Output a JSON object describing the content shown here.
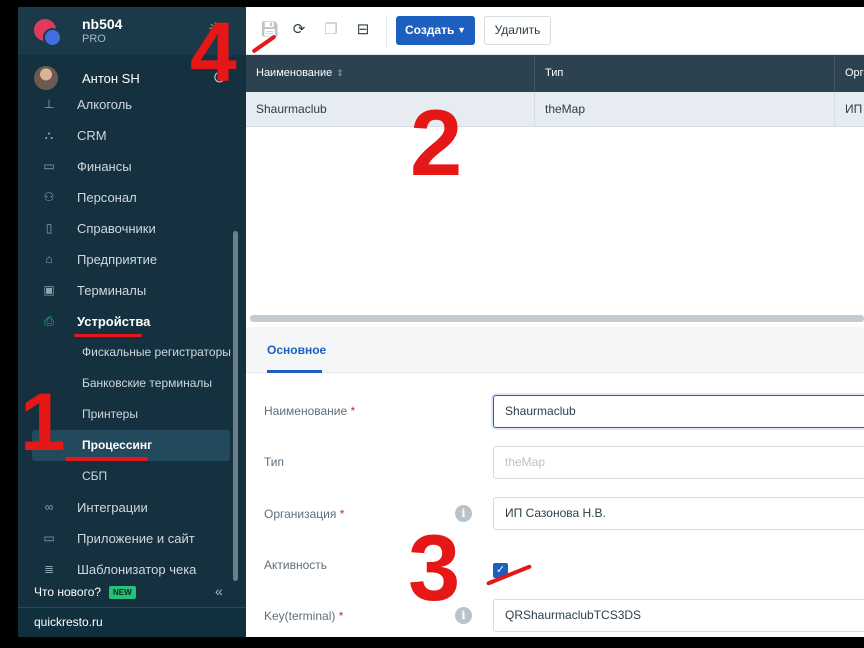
{
  "account": {
    "name": "nb504",
    "plan": "PRO"
  },
  "user": {
    "name": "Антон SH"
  },
  "sidebar": {
    "items": [
      {
        "label": "Алкоголь",
        "icon": "glass-icon"
      },
      {
        "label": "CRM",
        "icon": "org-chart-icon"
      },
      {
        "label": "Финансы",
        "icon": "wallet-icon"
      },
      {
        "label": "Персонал",
        "icon": "people-icon"
      },
      {
        "label": "Справочники",
        "icon": "book-icon"
      },
      {
        "label": "Предприятие",
        "icon": "store-icon"
      },
      {
        "label": "Терминалы",
        "icon": "qr-icon"
      },
      {
        "label": "Устройства",
        "icon": "printer-icon"
      },
      {
        "label": "Фискальные регистраторы"
      },
      {
        "label": "Банковские терминалы"
      },
      {
        "label": "Принтеры"
      },
      {
        "label": "Процессинг"
      },
      {
        "label": "СБП"
      },
      {
        "label": "Интеграции",
        "icon": "infinity-icon"
      },
      {
        "label": "Приложение и сайт",
        "icon": "monitor-icon"
      },
      {
        "label": "Шаблонизатор чека",
        "icon": "receipt-icon"
      }
    ],
    "whats_new": "Что нового?",
    "new_badge": "NEW",
    "footer": "quickresto.ru"
  },
  "toolbar": {
    "create_label": "Создать",
    "delete_label": "Удалить"
  },
  "table": {
    "columns": [
      "Наименование",
      "Тип",
      "Орга"
    ],
    "rows": [
      [
        "Shaurmaclub",
        "theMap",
        "ИП С"
      ]
    ]
  },
  "form": {
    "tab": "Основное",
    "fields": {
      "name": {
        "label": "Наименование",
        "value": "Shaurmaclub"
      },
      "type": {
        "label": "Тип",
        "value": "theMap"
      },
      "org": {
        "label": "Организация",
        "value": "ИП Сазонова Н.В."
      },
      "active": {
        "label": "Активность",
        "checked": true
      },
      "key": {
        "label": "Key(terminal)",
        "value": "QRShaurmaclubTCS3DS"
      }
    },
    "required_mark": "*"
  },
  "annotations": {
    "n1": "1",
    "n2": "2",
    "n3": "3",
    "n4": "4"
  },
  "colors": {
    "sidebar_bg": "#15313f",
    "accent": "#1d5fbf",
    "annotation": "#e61717"
  }
}
